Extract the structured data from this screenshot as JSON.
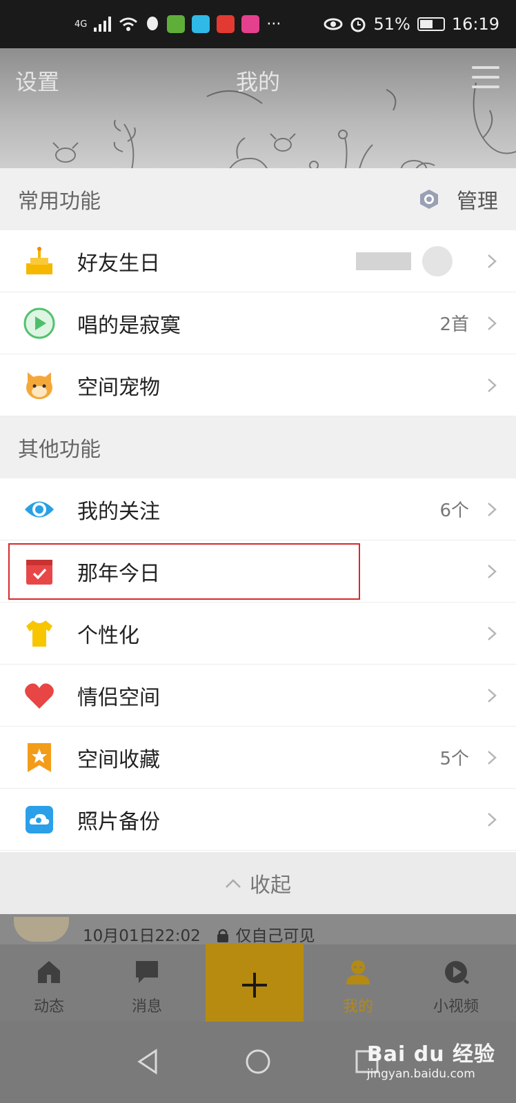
{
  "status_bar": {
    "network": "4G",
    "more": "···",
    "battery": "51%",
    "time": "16:19"
  },
  "header": {
    "left": "设置",
    "title": "我的"
  },
  "common_section": {
    "title": "常用功能",
    "manage_label": "管理",
    "items": [
      {
        "label": "好友生日",
        "meta": "",
        "icon": "cake-icon"
      },
      {
        "label": "唱的是寂寞",
        "meta": "2首",
        "icon": "play-icon"
      },
      {
        "label": "空间宠物",
        "meta": "",
        "icon": "pet-icon"
      }
    ]
  },
  "other_section": {
    "title": "其他功能",
    "items": [
      {
        "label": "我的关注",
        "meta": "6个",
        "icon": "eye-icon"
      },
      {
        "label": "那年今日",
        "meta": "",
        "icon": "calendar-check-icon"
      },
      {
        "label": "个性化",
        "meta": "",
        "icon": "tshirt-icon"
      },
      {
        "label": "情侣空间",
        "meta": "",
        "icon": "heart-icon"
      },
      {
        "label": "空间收藏",
        "meta": "5个",
        "icon": "bookmark-star-icon"
      },
      {
        "label": "照片备份",
        "meta": "",
        "icon": "cloud-icon"
      }
    ]
  },
  "collapse_label": "收起",
  "post": {
    "time": "10月01日22:02",
    "privacy": "仅自己可见"
  },
  "tabs": [
    {
      "label": "动态",
      "icon": "home-icon"
    },
    {
      "label": "消息",
      "icon": "message-icon"
    },
    {
      "label": "我的",
      "icon": "person-icon",
      "active": true
    },
    {
      "label": "小视频",
      "icon": "video-icon"
    }
  ],
  "colors": {
    "highlight_box": "#d7282a",
    "active_tab": "#b58a12",
    "plus_button": "#b78b10"
  },
  "watermark": {
    "brand": "Bai du 经验",
    "url": "jingyan.baidu.com"
  }
}
